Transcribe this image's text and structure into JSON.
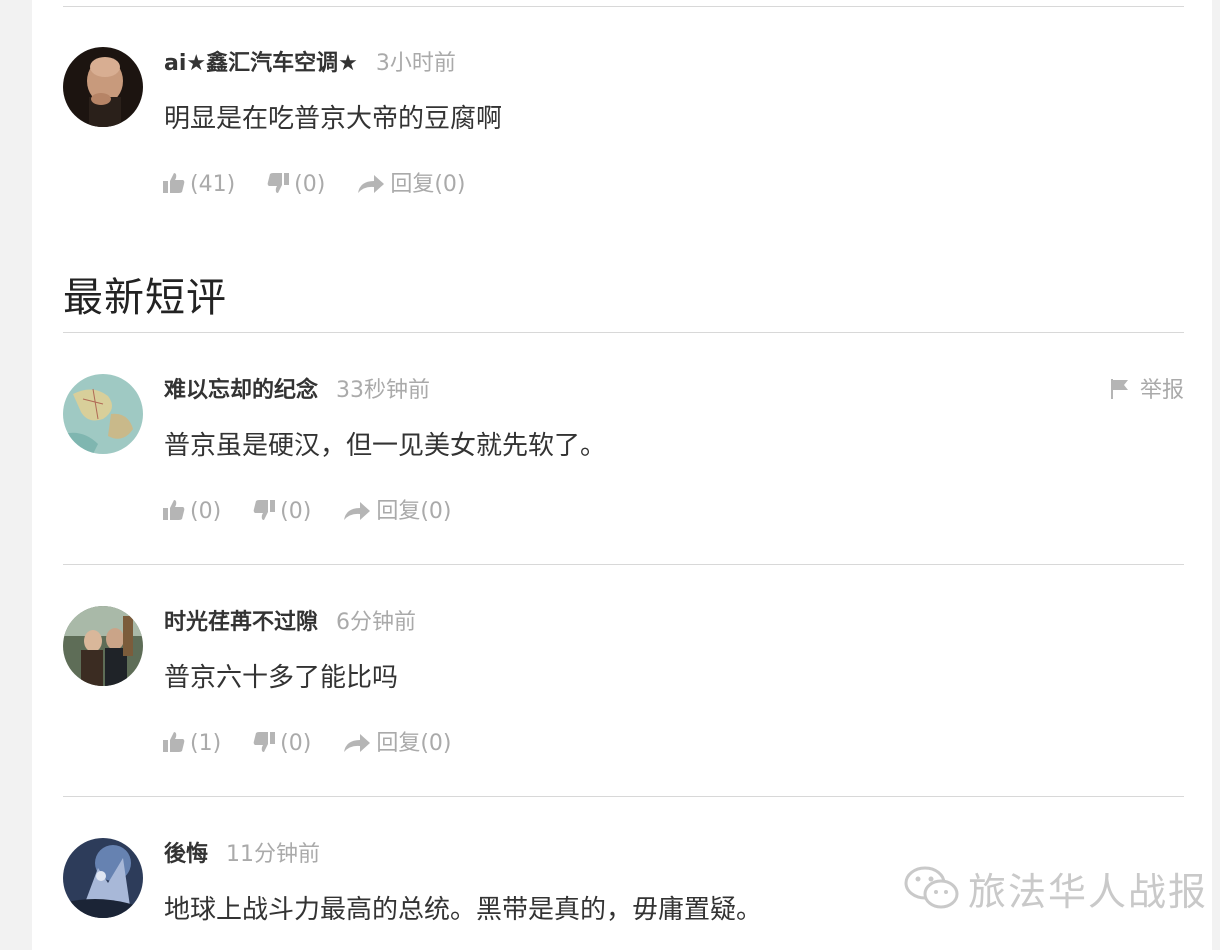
{
  "section_title": "最新短评",
  "top_comment": {
    "username": "ai★鑫汇汽车空调★",
    "time": "3小时前",
    "content": "明显是在吃普京大帝的豆腐啊",
    "like_count": "(41)",
    "dislike_count": "(0)",
    "reply_label": "回复(0)",
    "avatar_icon": "bald-man-avatar"
  },
  "comments": [
    {
      "username": "难以忘却的纪念",
      "time": "33秒钟前",
      "content": "普京虽是硬汉，但一见美女就先软了。",
      "like_count": "(0)",
      "dislike_count": "(0)",
      "reply_label": "回复(0)",
      "report_label": "举报",
      "avatar_icon": "map-avatar"
    },
    {
      "username": "时光荏苒不过隙",
      "time": "6分钟前",
      "content": "普京六十多了能比吗",
      "like_count": "(1)",
      "dislike_count": "(0)",
      "reply_label": "回复(0)",
      "avatar_icon": "couple-avatar"
    },
    {
      "username": "後悔",
      "time": "11分钟前",
      "content": "地球上战斗力最高的总统。黑带是真的，毋庸置疑。",
      "avatar_icon": "fantasy-avatar"
    }
  ],
  "watermark": {
    "text": "旅法华人战报",
    "icon": "wechat-icon"
  },
  "colors": {
    "text": "#333333",
    "muted": "#aaaaaa",
    "divider": "#d8d8d8"
  }
}
